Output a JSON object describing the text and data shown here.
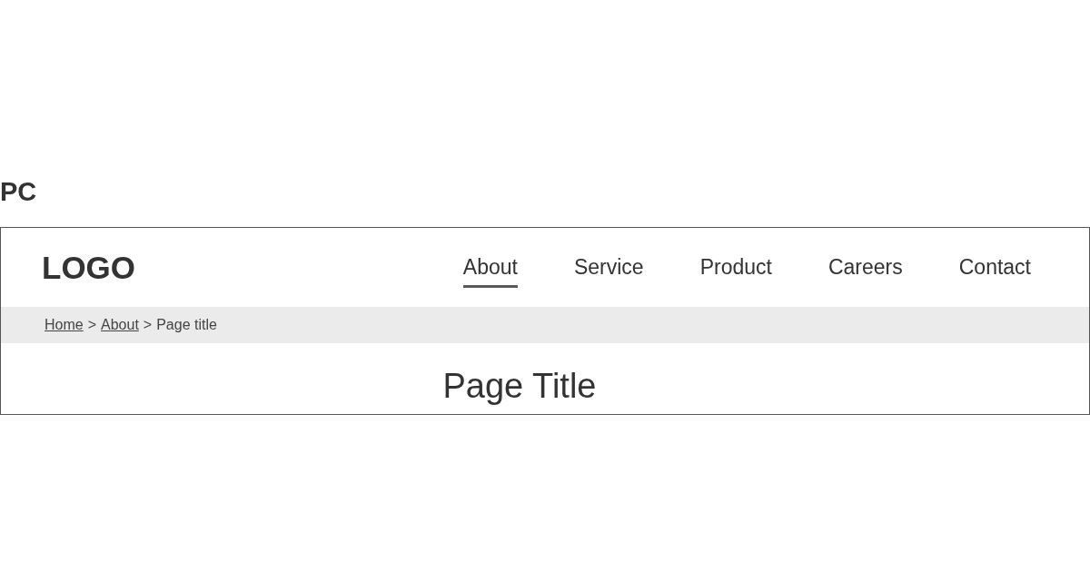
{
  "section_label": "PC",
  "header": {
    "logo": "LOGO",
    "nav": [
      {
        "label": "About",
        "selected": true
      },
      {
        "label": "Service",
        "selected": false
      },
      {
        "label": "Product",
        "selected": false
      },
      {
        "label": "Careers",
        "selected": false
      },
      {
        "label": "Contact",
        "selected": false
      }
    ]
  },
  "breadcrumb": {
    "separator": ">",
    "items": [
      {
        "label": "Home",
        "link": true
      },
      {
        "label": "About",
        "link": true
      },
      {
        "label": "Page title",
        "link": false
      }
    ]
  },
  "page_title": "Page Title"
}
